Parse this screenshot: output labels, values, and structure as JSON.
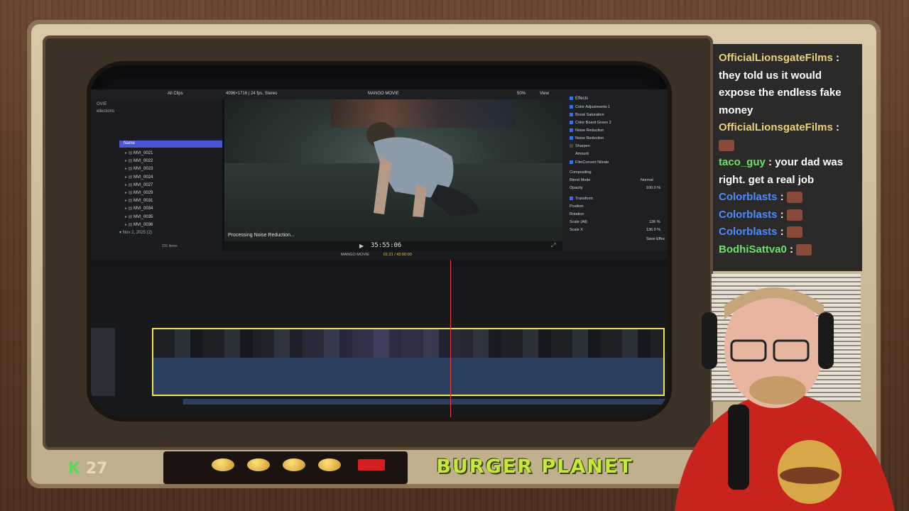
{
  "toolbar": {
    "all_clips": "All Clips",
    "format": "4096×1716 | 24 fps, Stereo",
    "project": "MANGO MOVIE",
    "zoom": "50%",
    "view": "View"
  },
  "browser": {
    "sidebar_labels": [
      "OVIE",
      "ellections"
    ],
    "name_header": "Name",
    "clips": [
      "MVI_0021",
      "MVI_0022",
      "MVI_0023",
      "MVI_0024",
      "MVI_0027",
      "MVI_0029",
      "MVI_0031",
      "MVI_0034",
      "MVI_0035",
      "MVI_0036"
    ],
    "date_group": "Nov 2, 2025",
    "date_count": "(2)",
    "item_count": "231 items"
  },
  "viewer": {
    "processing": "Processing Noise Reduction...",
    "timecode": "35:55:06"
  },
  "inspector": {
    "effects_title": "Effects",
    "effects": [
      "Color Adjustments 1",
      "Boost Saturation",
      "Color Board Green 2",
      "Noise Reduction",
      "Noise Reduction",
      "Sharpen"
    ],
    "amount_label": "Amount",
    "filmconvert": "FilmConvert Nitrate",
    "compositing": "Compositing",
    "blend_mode_label": "Blend Mode",
    "blend_mode_value": "Normal",
    "opacity_label": "Opacity",
    "opacity_value": "100.0 %",
    "transform": "Transform",
    "position_label": "Position",
    "rotation_label": "Rotation",
    "scale_all_label": "Scale (All)",
    "scale_all_value": "136 %",
    "scale_x_label": "Scale X",
    "scale_x_value": "136.0 %",
    "save_effects": "Save Effec"
  },
  "timeline": {
    "project_name": "MANGO MOVIE",
    "duration": "01:21 / 43:00:00"
  },
  "chat": [
    {
      "user": "OfficialLionsgateFilms",
      "user_color": "#e9d27a",
      "text": "they told us it would expose the endless fake money",
      "emotes": 0
    },
    {
      "user": "OfficialLionsgateFilms",
      "user_color": "#e9d27a",
      "text": "",
      "emotes": 1
    },
    {
      "user": "taco_guy",
      "user_color": "#6ee06a",
      "text": "your dad was right. get a real job",
      "emotes": 0
    },
    {
      "user": "Colorblasts",
      "user_color": "#4e8bff",
      "text": "",
      "emotes": 1
    },
    {
      "user": "Colorblasts",
      "user_color": "#4e8bff",
      "text": "",
      "emotes": 1
    },
    {
      "user": "Colorblasts",
      "user_color": "#4e8bff",
      "text": "",
      "emotes": 1
    },
    {
      "user": "BodhiSattva0",
      "user_color": "#6ee06a",
      "text": "",
      "emotes": 1
    }
  ],
  "overlay": {
    "k_letter": "K",
    "k_count": "27",
    "brand": "BURGER PLANET"
  }
}
